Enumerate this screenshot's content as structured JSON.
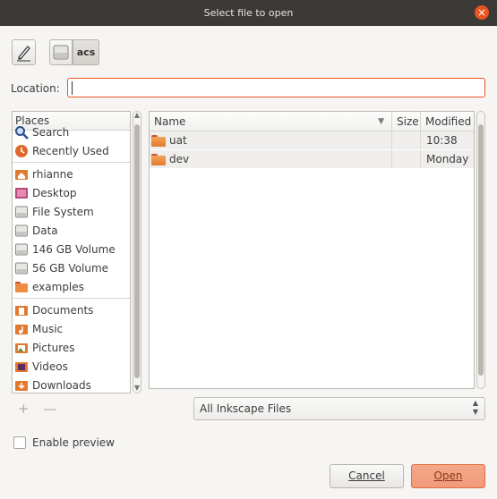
{
  "window": {
    "title": "Select file to open",
    "close_glyph": "×"
  },
  "toolbar": {
    "path_button_label": "acs",
    "edit_icon": "pencil-icon",
    "drive_icon": "drive-icon"
  },
  "location": {
    "label": "Location:",
    "value": ""
  },
  "places": {
    "header": "Places",
    "items": [
      {
        "label": "Search",
        "icon": "search-icon"
      },
      {
        "label": "Recently Used",
        "icon": "recent-icon"
      },
      {
        "label": "rhianne",
        "icon": "home-folder-icon"
      },
      {
        "label": "Desktop",
        "icon": "desktop-icon"
      },
      {
        "label": "File System",
        "icon": "drive-icon"
      },
      {
        "label": "Data",
        "icon": "drive-icon"
      },
      {
        "label": "146 GB Volume",
        "icon": "drive-icon"
      },
      {
        "label": "56 GB Volume",
        "icon": "drive-icon"
      },
      {
        "label": "examples",
        "icon": "folder-icon"
      },
      {
        "label": "Documents",
        "icon": "documents-icon"
      },
      {
        "label": "Music",
        "icon": "music-icon"
      },
      {
        "label": "Pictures",
        "icon": "pictures-icon"
      },
      {
        "label": "Videos",
        "icon": "videos-icon"
      },
      {
        "label": "Downloads",
        "icon": "downloads-icon"
      }
    ],
    "add_glyph": "+",
    "remove_glyph": "—"
  },
  "files": {
    "columns": {
      "name": "Name",
      "size": "Size",
      "modified": "Modified"
    },
    "rows": [
      {
        "name": "uat",
        "size": "",
        "modified": "10:38"
      },
      {
        "name": "dev",
        "size": "",
        "modified": "Monday"
      }
    ]
  },
  "filter": {
    "value": "All Inkscape Files"
  },
  "preview": {
    "label": "Enable preview",
    "checked": false
  },
  "buttons": {
    "cancel": "Cancel",
    "open": "Open"
  },
  "colors": {
    "accent": "#e95420",
    "titlebar": "#3b3a36",
    "open_button": "#f09a7a"
  }
}
